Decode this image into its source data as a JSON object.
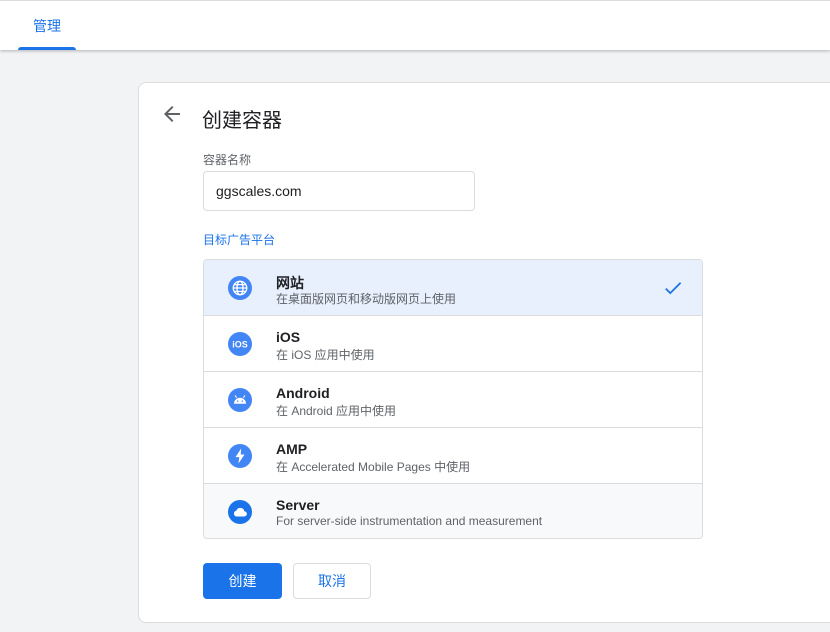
{
  "header": {
    "tab_label": "管理"
  },
  "dialog": {
    "title": "创建容器",
    "name_label": "容器名称",
    "name_value": "ggscales.com",
    "platform_label": "目标广告平台",
    "platforms": [
      {
        "title": "网站",
        "subtitle": "在桌面版网页和移动版网页上使用",
        "icon": "globe-icon",
        "selected": true
      },
      {
        "title": "iOS",
        "subtitle": "在 iOS 应用中使用",
        "icon": "ios-icon",
        "selected": false
      },
      {
        "title": "Android",
        "subtitle": "在 Android 应用中使用",
        "icon": "android-icon",
        "selected": false
      },
      {
        "title": "AMP",
        "subtitle": "在 Accelerated Mobile Pages 中使用",
        "icon": "amp-bolt-icon",
        "selected": false
      },
      {
        "title": "Server",
        "subtitle": "For server-side instrumentation and measurement",
        "icon": "cloud-icon",
        "selected": false
      }
    ],
    "create_label": "创建",
    "cancel_label": "取消"
  },
  "colors": {
    "accent": "#1a73e8",
    "icon_blue": "#4285f4",
    "selected_bg": "#e8f0fe"
  }
}
